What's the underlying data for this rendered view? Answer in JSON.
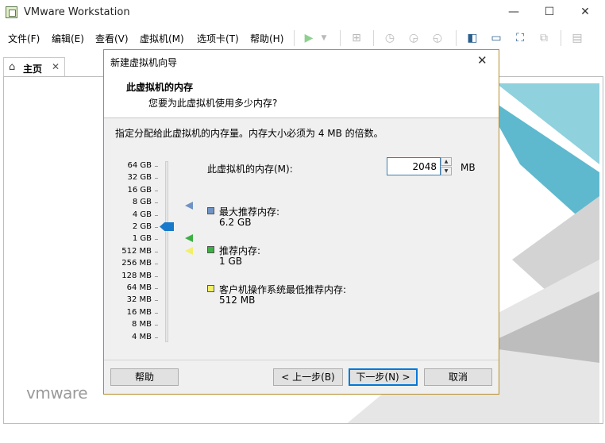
{
  "window": {
    "title": "VMware Workstation",
    "minimize": "—",
    "maximize": "☐",
    "close": "✕"
  },
  "menu": [
    {
      "label": "文件(F)"
    },
    {
      "label": "编辑(E)"
    },
    {
      "label": "查看(V)"
    },
    {
      "label": "虚拟机(M)"
    },
    {
      "label": "选项卡(T)"
    },
    {
      "label": "帮助(H)"
    }
  ],
  "toolbar_icons": [
    "play-icon",
    "dropdown-icon",
    "network-icon",
    "snapshot-icon",
    "revert-snapshot-icon",
    "manage-snapshots-icon",
    "sidebar-icon",
    "console-icon",
    "fullscreen-icon",
    "unity-icon",
    "thumbnail-icon"
  ],
  "tab": {
    "label": "主页",
    "close": "✕"
  },
  "logo": {
    "text": "vmware"
  },
  "dialog": {
    "title": "新建虚拟机向导",
    "close": "✕",
    "heading": "此虚拟机的内存",
    "subheading": "您要为此虚拟机使用多少内存?",
    "instruction": "指定分配给此虚拟机的内存量。内存大小必须为 4 MB 的倍数。",
    "scale": [
      "64 GB",
      "32 GB",
      "16 GB",
      "8 GB",
      "4 GB",
      "2 GB",
      "1 GB",
      "512 MB",
      "256 MB",
      "128 MB",
      "64 MB",
      "32 MB",
      "16 MB",
      "8 MB",
      "4 MB"
    ],
    "memory": {
      "label": "此虚拟机的内存(M):",
      "value": "2048",
      "unit": "MB",
      "spin_up": "▲",
      "spin_down": "▼"
    },
    "legend": [
      {
        "title": "最大推荐内存:",
        "value": "6.2 GB",
        "color": "#6f93c4"
      },
      {
        "title": "推荐内存:",
        "value": "1 GB",
        "color": "#3cb043"
      },
      {
        "title": "客户机操作系统最低推荐内存:",
        "value": "512 MB",
        "color": "#f2ef6a"
      }
    ],
    "buttons": {
      "help": "帮助",
      "back": "< 上一步(B)",
      "next": "下一步(N) >",
      "cancel": "取消"
    }
  }
}
